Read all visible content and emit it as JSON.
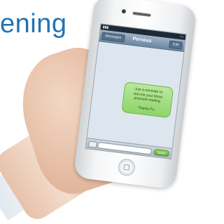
{
  "slide": {
    "title": "ening"
  },
  "phone": {
    "nav_bar": {
      "back_label": "Messages",
      "title": "Perseus",
      "edit_label": "Edit"
    },
    "message": {
      "lines": [
        "Just a reminder to",
        "text me your blood",
        "pressure reading."
      ],
      "signature": "Thanks Fo."
    },
    "input_bar": {
      "send_label": "Send"
    }
  },
  "colors": {
    "title": "#1f73b7",
    "bubble": "#8fd46a",
    "nav_bar": "#6b86a0"
  }
}
